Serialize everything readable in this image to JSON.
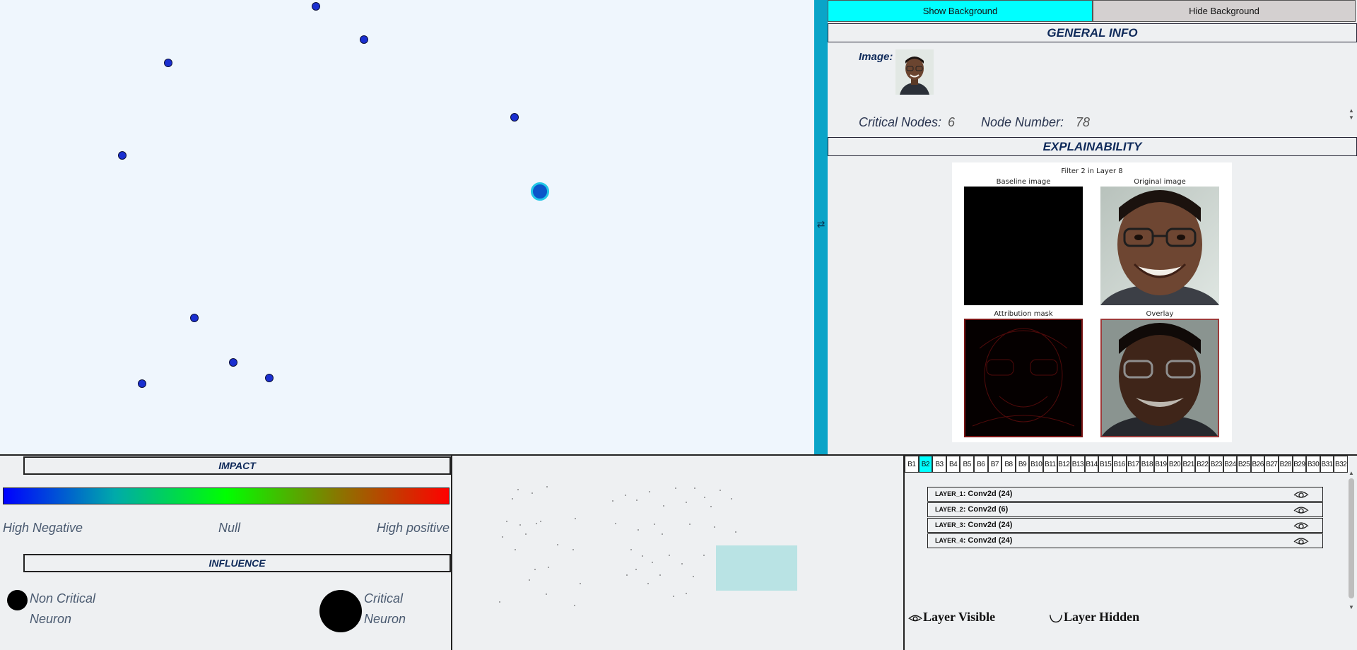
{
  "top_buttons": {
    "show_background": "Show Background",
    "hide_background": "Hide Background"
  },
  "general_info": {
    "title": "GENERAL INFO",
    "image_label": "Image:",
    "critical_nodes_label": "Critical Nodes:",
    "critical_nodes_value": "6",
    "node_number_label": "Node Number:",
    "node_number_value": "78"
  },
  "explainability": {
    "title": "EXPLAINABILITY",
    "figure_title": "Filter 2 in Layer 8",
    "panels": [
      "Baseline image",
      "Original image",
      "Attribution mask",
      "Overlay"
    ]
  },
  "impact": {
    "title": "IMPACT",
    "low_label": "High Negative",
    "mid_label": "Null",
    "high_label": "High positive",
    "gradient_colors": [
      "#0000ff",
      "#00ff00",
      "#ff0000"
    ]
  },
  "influence": {
    "title": "INFLUENCE",
    "non_critical_line1": "Non Critical",
    "non_critical_line2": "Neuron",
    "critical_line1": "Critical",
    "critical_line2": "Neuron"
  },
  "batches": {
    "labels": [
      "B1",
      "B2",
      "B3",
      "B4",
      "B5",
      "B6",
      "B7",
      "B8",
      "B9",
      "B10",
      "B11",
      "B12",
      "B13",
      "B14",
      "B15",
      "B16",
      "B17",
      "B18",
      "B19",
      "B20",
      "B21",
      "B22",
      "B23",
      "B24",
      "B25",
      "B26",
      "B27",
      "B28",
      "B29",
      "B30",
      "B31",
      "B32"
    ],
    "active": "B2"
  },
  "layers": [
    {
      "prefix": "LAYER_1",
      "type": "Conv2d",
      "count": "(24)"
    },
    {
      "prefix": "LAYER_2",
      "type": "Conv2d",
      "count": "(6)"
    },
    {
      "prefix": "LAYER_3",
      "type": "Conv2d",
      "count": "(24)"
    },
    {
      "prefix": "LAYER_4",
      "type": "Conv2d",
      "count": "(24)"
    }
  ],
  "layer_legend": {
    "visible": "Layer Visible",
    "hidden": "Layer Hidden"
  },
  "colors": {
    "accent": "#00ffff",
    "splitter": "#0aa4c8",
    "node": "#1a2fd0",
    "title_text": "#0f2a5a"
  }
}
